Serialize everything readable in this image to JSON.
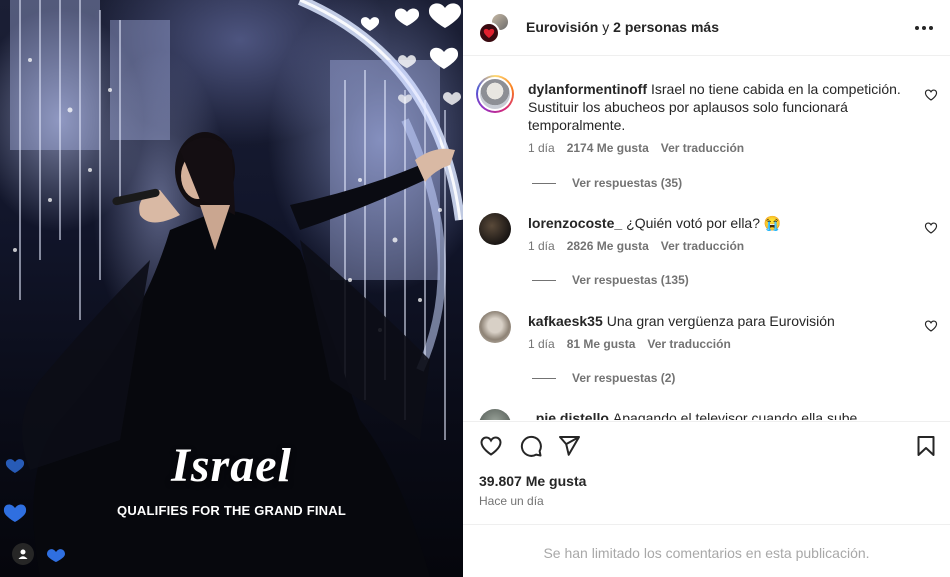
{
  "media": {
    "title": "Israel",
    "subtitle": "QUALIFIES FOR THE GRAND FINAL",
    "tag_icon": "user-icon"
  },
  "header": {
    "title_bold": "Eurovisión",
    "title_normal": " y ",
    "title_bold2": "2 personas más",
    "more_icon": "more-horizontal-icon"
  },
  "comments": [
    {
      "username": "dylanformentinoff",
      "text": "Israel no tiene cabida en la competición. Sustituir los abucheos por aplausos solo funcionará temporalmente.",
      "time": "1 día",
      "likes": "2174 Me gusta",
      "translate": "Ver traducción",
      "replies": "Ver respuestas (35)"
    },
    {
      "username": "lorenzocoste_",
      "text": "¿Quién votó por ella? 😭",
      "time": "1 día",
      "likes": "2826 Me gusta",
      "translate": "Ver traducción",
      "replies": "Ver respuestas (135)"
    },
    {
      "username": "kafkaesk35",
      "text": "Una gran vergüenza para Eurovisión",
      "time": "1 día",
      "likes": "81 Me gusta",
      "translate": "Ver traducción",
      "replies": "Ver respuestas (2)"
    },
    {
      "username": "_pie.distello",
      "text": "Apagando el televisor cuando ella sube"
    }
  ],
  "post": {
    "likes": "39.807 Me gusta",
    "time": "Hace un día",
    "footer": "Se han limitado los comentarios en esta publicación."
  },
  "colors": {
    "text": "#262626",
    "secondary": "#737373",
    "muted": "#a8a8a8",
    "divider": "#efefef"
  }
}
